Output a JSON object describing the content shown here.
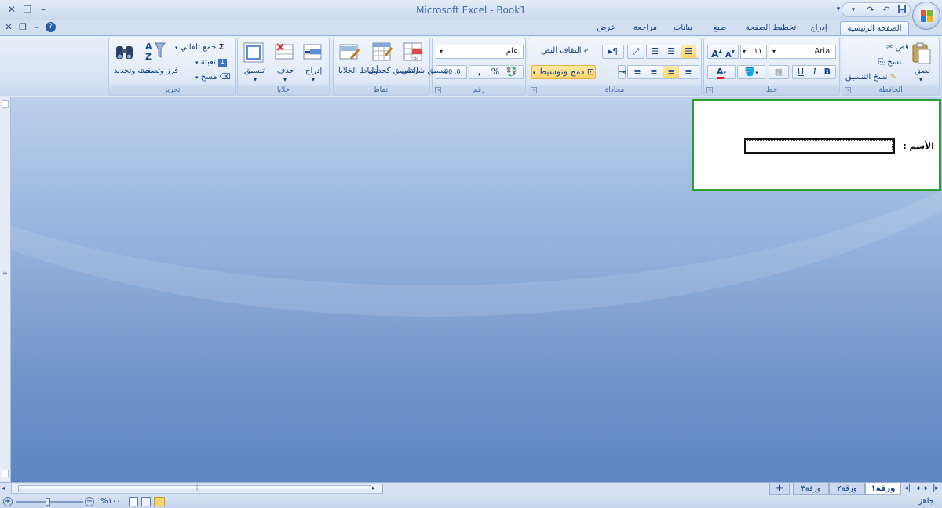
{
  "window": {
    "title": "Microsoft Excel - Book1",
    "minimize": "–",
    "restore": "❐",
    "close": "✕"
  },
  "qat": {
    "save_icon": "save-icon",
    "undo_icon": "undo-icon",
    "redo_icon": "redo-icon",
    "customize": "▾"
  },
  "workbook_controls": {
    "close": "✕",
    "restore": "❐",
    "minimize": "–",
    "help": "?"
  },
  "tabs": [
    {
      "label": "الصفحة الرئيسية",
      "active": true
    },
    {
      "label": "إدراج"
    },
    {
      "label": "تخطيط الصفحة"
    },
    {
      "label": "صيغ"
    },
    {
      "label": "بيانات"
    },
    {
      "label": "مراجعة"
    },
    {
      "label": "عرض"
    }
  ],
  "clipboard": {
    "label": "الحافظة",
    "paste": "لصق",
    "cut": "قص",
    "copy": "نسخ",
    "format_painter": "نسخ التنسيق"
  },
  "font": {
    "label": "خط",
    "family": "Arial",
    "size": "١١",
    "bold": "B",
    "italic": "I",
    "underline": "U",
    "grow": "A",
    "shrink": "A",
    "font_color": "A"
  },
  "alignment": {
    "label": "محاذاة",
    "wrap_text": "التفاف النص",
    "merge_center": "دمج وتوسيط"
  },
  "number": {
    "label": "رقم",
    "format": "عام",
    "percent": "%",
    "comma": ",",
    "inc_decimal": ".00",
    "dec_decimal": ".0"
  },
  "styles": {
    "label": "أنماط",
    "conditional": "تنسيق شرطي",
    "format_table": "التنسيق كجدول",
    "cell_styles": "أنماط الخلايا"
  },
  "cells": {
    "label": "خلايا",
    "insert": "إدراج",
    "delete": "حذف",
    "format": "تنسيق"
  },
  "editing": {
    "label": "تحرير",
    "autosum": "جمع تلقائي",
    "fill": "تعبئة",
    "clear": "مسح",
    "sort_filter": "فرز وتصفية",
    "find_select": "بحث وتحديد"
  },
  "form": {
    "name_label": "الأسم :",
    "name_value": ""
  },
  "sheets": [
    "ورقة١",
    "ورقة٢",
    "ورقة٣"
  ],
  "status": {
    "ready": "جاهز",
    "zoom": "%١٠٠"
  },
  "colors": {
    "accent": "#15428b",
    "form_border": "#2ca02c",
    "highlight": "#ffd56a"
  }
}
